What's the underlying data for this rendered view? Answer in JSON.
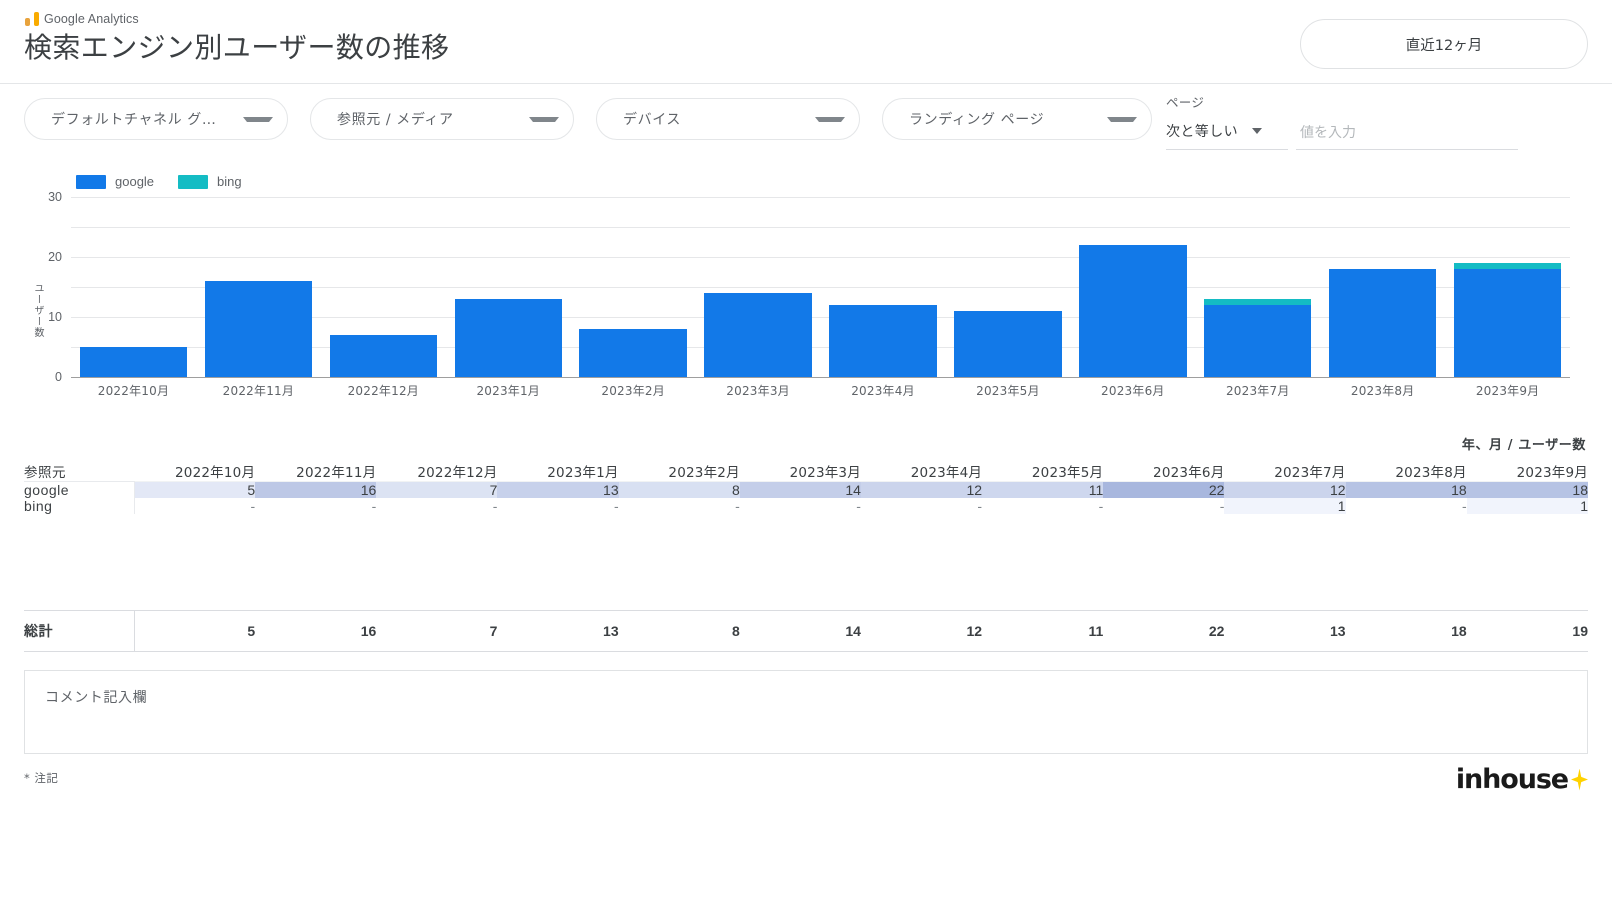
{
  "header": {
    "brand": "Google Analytics",
    "brand_icon": "google-analytics-logo",
    "title": "検索エンジン別ユーザー数の推移",
    "date_range": "直近12ヶ月"
  },
  "filters": {
    "chips": [
      {
        "label": "デフォルトチャネル グル…",
        "icon": "chevron-down-icon"
      },
      {
        "label": "参照元 / メディア",
        "icon": "chevron-down-icon"
      },
      {
        "label": "デバイス",
        "icon": "chevron-down-icon"
      },
      {
        "label": "ランディング ページ",
        "icon": "chevron-down-icon"
      }
    ],
    "page_filter": {
      "label": "ページ",
      "operator": "次と等しい",
      "value": "",
      "placeholder": "値を入力"
    }
  },
  "chart_data": {
    "type": "bar",
    "stacked": true,
    "title": "",
    "xlabel": "",
    "ylabel": "ユーザー数",
    "ylim": [
      0,
      30
    ],
    "yticks": [
      0,
      10,
      20,
      30
    ],
    "gridlines": [
      0,
      5,
      10,
      15,
      20,
      25,
      30
    ],
    "grid": true,
    "legend_position": "top-left",
    "categories": [
      "2022年10月",
      "2022年11月",
      "2022年12月",
      "2023年1月",
      "2023年2月",
      "2023年3月",
      "2023年4月",
      "2023年5月",
      "2023年6月",
      "2023年7月",
      "2023年8月",
      "2023年9月"
    ],
    "series": [
      {
        "name": "google",
        "color": "#1279e8",
        "values": [
          5,
          16,
          7,
          13,
          8,
          14,
          12,
          11,
          22,
          12,
          18,
          18
        ]
      },
      {
        "name": "bing",
        "color": "#14bcc4",
        "values": [
          0,
          0,
          0,
          0,
          0,
          0,
          0,
          0,
          0,
          1,
          0,
          1
        ]
      }
    ]
  },
  "table": {
    "metric_label": "年、月 / ユーザー数",
    "dimension_header": "参照元",
    "columns": [
      "2022年10月",
      "2022年11月",
      "2022年12月",
      "2023年1月",
      "2023年2月",
      "2023年3月",
      "2023年4月",
      "2023年5月",
      "2023年6月",
      "2023年7月",
      "2023年8月",
      "2023年9月"
    ],
    "rows": [
      {
        "name": "google",
        "values": [
          "5",
          "16",
          "7",
          "13",
          "8",
          "14",
          "12",
          "11",
          "22",
          "12",
          "18",
          "18"
        ]
      },
      {
        "name": "bing",
        "values": [
          "-",
          "-",
          "-",
          "-",
          "-",
          "-",
          "-",
          "-",
          "-",
          "1",
          "-",
          "1"
        ]
      }
    ],
    "total_label": "総計",
    "totals": [
      "5",
      "16",
      "7",
      "13",
      "8",
      "14",
      "12",
      "11",
      "22",
      "13",
      "18",
      "19"
    ]
  },
  "comment": {
    "text": "コメント記入欄"
  },
  "footer": {
    "note": "* 注記",
    "logo_text": "inhouse",
    "logo_icon": "spark-icon"
  },
  "colors": {
    "google": "#1279e8",
    "bing": "#14bcc4",
    "heat_max": "#aebbe0",
    "accent_yellow": "#ffd200"
  }
}
